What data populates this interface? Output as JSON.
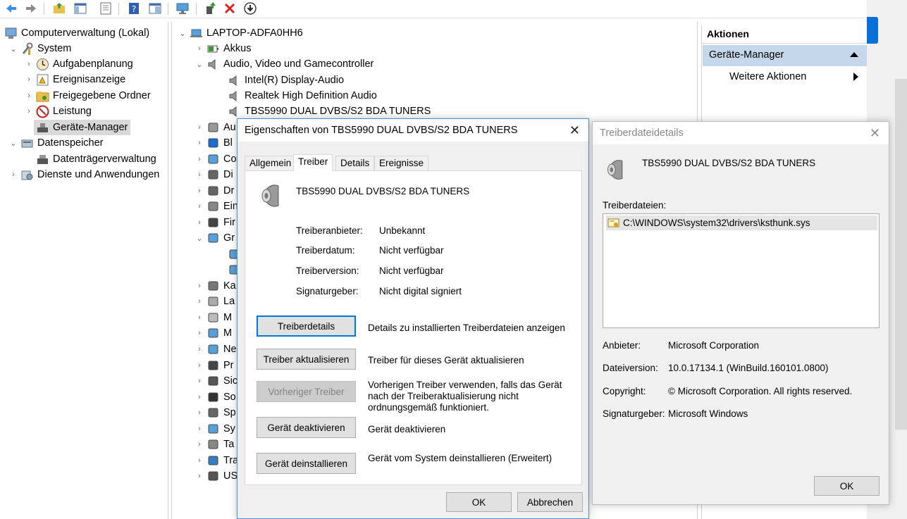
{
  "toolbar": {
    "icons": [
      "back-icon",
      "forward-icon",
      "up-folder-icon",
      "show-hide-tree-icon",
      "properties-icon",
      "help-icon",
      "console-tree-icon",
      "computer-monitor-icon",
      "update-driver-icon",
      "uninstall-icon",
      "download-icon"
    ]
  },
  "left_tree": {
    "root": "Computerverwaltung (Lokal)",
    "system": "System",
    "aufgabenplanung": "Aufgabenplanung",
    "ereignisanzeige": "Ereignisanzeige",
    "freigegebene_ordner": "Freigegebene Ordner",
    "leistung": "Leistung",
    "geraete_manager": "Geräte-Manager",
    "datenspeicher": "Datenspeicher",
    "datentraegerverwaltung": "Datenträgerverwaltung",
    "dienste": "Dienste und Anwendungen"
  },
  "device_tree": {
    "computer": "LAPTOP-ADFA0HH6",
    "akkus": "Akkus",
    "audio_group": "Audio, Video und Gamecontroller",
    "intel_audio": "Intel(R) Display-Audio",
    "realtek": "Realtek High Definition Audio",
    "tbs": "TBS5990 DUAL DVBS/S2 BDA TUNERS",
    "partial": [
      "Au",
      "Bl",
      "Co",
      "Di",
      "Dr",
      "Ein",
      "Fir",
      "Gr",
      "",
      "",
      "Ka",
      "La",
      "M",
      "M",
      "Ne",
      "Pr",
      "Sic",
      "So",
      "Sp",
      "Sy",
      "Ta",
      "Tra",
      "US"
    ]
  },
  "actions": {
    "header": "Aktionen",
    "geraete_manager": "Geräte-Manager",
    "weitere": "Weitere Aktionen"
  },
  "prop_dialog": {
    "title": "Eigenschaften von TBS5990 DUAL DVBS/S2 BDA TUNERS",
    "tabs": [
      "Allgemein",
      "Treiber",
      "Details",
      "Ereignisse"
    ],
    "device_name": "TBS5990 DUAL DVBS/S2 BDA TUNERS",
    "fields": [
      {
        "label": "Treiberanbieter:",
        "value": "Unbekannt"
      },
      {
        "label": "Treiberdatum:",
        "value": "Nicht verfügbar"
      },
      {
        "label": "Treiberversion:",
        "value": "Nicht verfügbar"
      },
      {
        "label": "Signaturgeber:",
        "value": "Nicht digital signiert"
      }
    ],
    "buttons": [
      {
        "label": "Treiberdetails",
        "desc": "Details zu installierten Treiberdateien anzeigen"
      },
      {
        "label": "Treiber aktualisieren",
        "desc": "Treiber für dieses Gerät aktualisieren"
      },
      {
        "label": "Vorheriger Treiber",
        "desc": "Vorherigen Treiber verwenden, falls das Gerät nach der Treiberaktualisierung nicht ordnungsgemäß funktioniert."
      },
      {
        "label": "Gerät deaktivieren",
        "desc": "Gerät deaktivieren"
      },
      {
        "label": "Gerät deinstallieren",
        "desc": "Gerät vom System deinstallieren (Erweitert)"
      }
    ],
    "ok": "OK",
    "cancel": "Abbrechen"
  },
  "files_dialog": {
    "title": "Treiberdateidetails",
    "device_name": "TBS5990 DUAL DVBS/S2 BDA TUNERS",
    "files_label": "Treiberdateien:",
    "file": "C:\\WINDOWS\\system32\\drivers\\ksthunk.sys",
    "fields": [
      {
        "label": "Anbieter:",
        "value": "Microsoft Corporation"
      },
      {
        "label": "Dateiversion:",
        "value": "10.0.17134.1 (WinBuild.160101.0800)"
      },
      {
        "label": "Copyright:",
        "value": "© Microsoft Corporation. All rights reserved."
      },
      {
        "label": "Signaturgeber:",
        "value": "Microsoft Windows"
      }
    ],
    "ok": "OK"
  },
  "colors": {
    "dialog_bg": "#f0f0f0",
    "selection": "#c5d7ea",
    "focus_blue": "#0078d7",
    "accent_blue": "#0a6fd6"
  }
}
